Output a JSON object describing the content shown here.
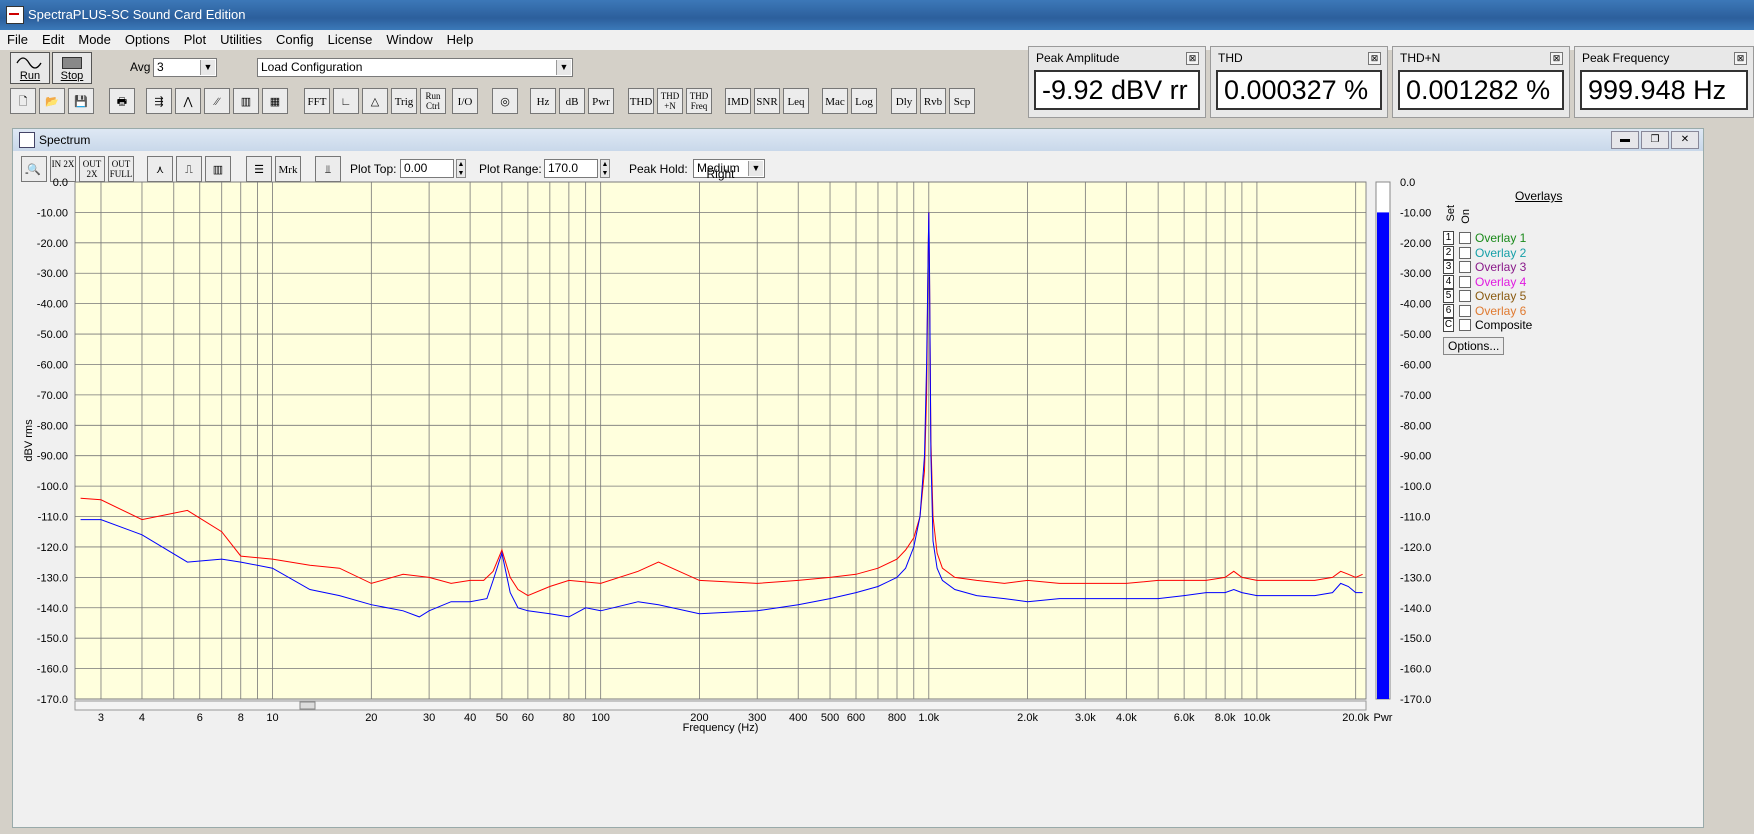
{
  "window": {
    "title": "SpectraPLUS-SC Sound Card Edition"
  },
  "menu": [
    "File",
    "Edit",
    "Mode",
    "Options",
    "Plot",
    "Utilities",
    "Config",
    "License",
    "Window",
    "Help"
  ],
  "toolbar": {
    "run_label": "Run",
    "stop_label": "Stop",
    "avg_label": "Avg",
    "avg_value": "3",
    "config_value": "Load Configuration",
    "buttons": [
      "FFT",
      "Trig",
      "Run Ctrl",
      "I/O",
      "Hz",
      "dB",
      "Pwr",
      "THD",
      "THD +N",
      "THD Freq",
      "IMD",
      "SNR",
      "Leq",
      "Mac",
      "Log",
      "Dly",
      "Rvb",
      "Scp"
    ]
  },
  "meters": [
    {
      "title": "Peak Amplitude",
      "value": "-9.92 dBV rr"
    },
    {
      "title": "THD",
      "value": "0.000327 %"
    },
    {
      "title": "THD+N",
      "value": "0.001282 %"
    },
    {
      "title": "Peak Frequency",
      "value": "999.948 Hz"
    }
  ],
  "spectrum": {
    "title": "Spectrum",
    "tool_buttons": [
      "IN 2X",
      "OUT 2X",
      "OUT FULL",
      "Mrk"
    ],
    "plot_top_label": "Plot Top:",
    "plot_top_value": "0.00",
    "plot_range_label": "Plot Range:",
    "plot_range_value": "170.0",
    "peak_hold_label": "Peak Hold:",
    "peak_hold_value": "Medium",
    "collapse_glyph": "-"
  },
  "overlays": {
    "title": "Overlays",
    "set_label": "Set",
    "on_label": "On",
    "items": [
      {
        "set": "1",
        "name": "Overlay 1",
        "color": "#1a8a1a"
      },
      {
        "set": "2",
        "name": "Overlay 2",
        "color": "#16a0a8"
      },
      {
        "set": "3",
        "name": "Overlay 3",
        "color": "#8a1a8a"
      },
      {
        "set": "4",
        "name": "Overlay 4",
        "color": "#e01ae0"
      },
      {
        "set": "5",
        "name": "Overlay 5",
        "color": "#8a5a10"
      },
      {
        "set": "6",
        "name": "Overlay 6",
        "color": "#e07a30"
      },
      {
        "set": "C",
        "name": "Composite",
        "color": "#000000"
      }
    ],
    "options_label": "Options..."
  },
  "chart_data": {
    "type": "line",
    "title": "Right",
    "xlabel": "Frequency (Hz)",
    "ylabel": "dBV rms",
    "x_scale": "log",
    "xlim": [
      2.5,
      21500
    ],
    "ylim": [
      -170,
      0
    ],
    "grid": true,
    "background": "#ffffdd",
    "y_ticks": [
      "0.0",
      "-10.00",
      "-20.00",
      "-30.00",
      "-40.00",
      "-50.00",
      "-60.00",
      "-70.00",
      "-80.00",
      "-90.00",
      "-100.0",
      "-110.0",
      "-120.0",
      "-130.0",
      "-140.0",
      "-150.0",
      "-160.0",
      "-170.0"
    ],
    "bar_ticks": [
      "0.0",
      "-10.00",
      "-20.00",
      "-30.00",
      "-40.00",
      "-50.00",
      "-60.00",
      "-70.00",
      "-80.00",
      "-90.00",
      "-100.0",
      "-110.0",
      "-120.0",
      "-130.0",
      "-140.0",
      "-150.0",
      "-160.0",
      "-170.0"
    ],
    "x_ticks": [
      {
        "v": 3,
        "t": "3"
      },
      {
        "v": 4,
        "t": "4"
      },
      {
        "v": 6,
        "t": "6"
      },
      {
        "v": 8,
        "t": "8"
      },
      {
        "v": 10,
        "t": "10"
      },
      {
        "v": 20,
        "t": "20"
      },
      {
        "v": 30,
        "t": "30"
      },
      {
        "v": 40,
        "t": "40"
      },
      {
        "v": 50,
        "t": "50"
      },
      {
        "v": 60,
        "t": "60"
      },
      {
        "v": 80,
        "t": "80"
      },
      {
        "v": 100,
        "t": "100"
      },
      {
        "v": 200,
        "t": "200"
      },
      {
        "v": 300,
        "t": "300"
      },
      {
        "v": 400,
        "t": "400"
      },
      {
        "v": 500,
        "t": "500"
      },
      {
        "v": 600,
        "t": "600"
      },
      {
        "v": 800,
        "t": "800"
      },
      {
        "v": 1000,
        "t": "1.0k"
      },
      {
        "v": 2000,
        "t": "2.0k"
      },
      {
        "v": 3000,
        "t": "3.0k"
      },
      {
        "v": 4000,
        "t": "4.0k"
      },
      {
        "v": 6000,
        "t": "6.0k"
      },
      {
        "v": 8000,
        "t": "8.0k"
      },
      {
        "v": 10000,
        "t": "10.0k"
      },
      {
        "v": 20000,
        "t": "20.0k"
      }
    ],
    "series": [
      {
        "color": "#ff0000",
        "x": [
          2.6,
          3,
          4,
          5.5,
          7,
          8,
          10,
          13,
          16,
          20,
          25,
          30,
          35,
          40,
          44,
          47,
          50,
          53,
          56,
          60,
          70,
          80,
          100,
          130,
          150,
          200,
          300,
          400,
          500,
          600,
          700,
          800,
          850,
          900,
          940,
          970,
          985,
          995,
          1000,
          1005,
          1015,
          1030,
          1060,
          1100,
          1200,
          1400,
          1700,
          2000,
          2500,
          3000,
          4000,
          5000,
          6000,
          7000,
          8000,
          8500,
          9000,
          10000,
          12000,
          15000,
          17000,
          18000,
          19000,
          20000,
          21000
        ],
        "y": [
          -104,
          -104.5,
          -111,
          -108,
          -115,
          -123,
          -124,
          -126,
          -127,
          -132,
          -129,
          -130,
          -132,
          -131,
          -131,
          -128,
          -121,
          -130,
          -134,
          -136,
          -133,
          -131,
          -132,
          -128,
          -125,
          -131,
          -132,
          -131,
          -130,
          -129,
          -127,
          -124,
          -121,
          -117,
          -110,
          -95,
          -70,
          -25,
          -10,
          -30,
          -85,
          -110,
          -122,
          -127,
          -130,
          -131,
          -132,
          -131,
          -132,
          -132,
          -132,
          -131,
          -131,
          -131,
          -130,
          -128,
          -130,
          -131,
          -131,
          -131,
          -130,
          -128,
          -129,
          -130,
          -129
        ]
      },
      {
        "color": "#0000ff",
        "x": [
          2.6,
          3,
          4,
          5.5,
          7,
          8,
          10,
          13,
          16,
          20,
          25,
          28,
          30,
          35,
          40,
          45,
          47,
          50,
          53,
          56,
          60,
          70,
          80,
          90,
          100,
          130,
          150,
          200,
          300,
          400,
          500,
          600,
          700,
          800,
          850,
          900,
          940,
          970,
          985,
          995,
          1000,
          1005,
          1015,
          1030,
          1060,
          1100,
          1200,
          1400,
          1700,
          2000,
          2500,
          3000,
          4000,
          5000,
          6000,
          7000,
          8000,
          8500,
          9000,
          10000,
          12000,
          15000,
          17000,
          18000,
          19000,
          20000,
          21000
        ],
        "y": [
          -111,
          -111,
          -116,
          -125,
          -124,
          -125,
          -127,
          -134,
          -136,
          -139,
          -141,
          -143,
          -141,
          -138,
          -138,
          -137,
          -131,
          -122,
          -135,
          -140,
          -141,
          -142,
          -143,
          -140,
          -141,
          -138,
          -139,
          -142,
          -141,
          -139,
          -137,
          -135,
          -133,
          -130,
          -127,
          -120,
          -110,
          -90,
          -60,
          -25,
          -10,
          -28,
          -90,
          -118,
          -127,
          -131,
          -134,
          -136,
          -137,
          -138,
          -137,
          -137,
          -137,
          -137,
          -136,
          -135,
          -135,
          -134,
          -135,
          -136,
          -136,
          -136,
          -135,
          -132,
          -133,
          -135,
          -135
        ]
      }
    ],
    "level_bar": {
      "label": "Pwr",
      "value": -10,
      "color": "#0000ff"
    }
  }
}
